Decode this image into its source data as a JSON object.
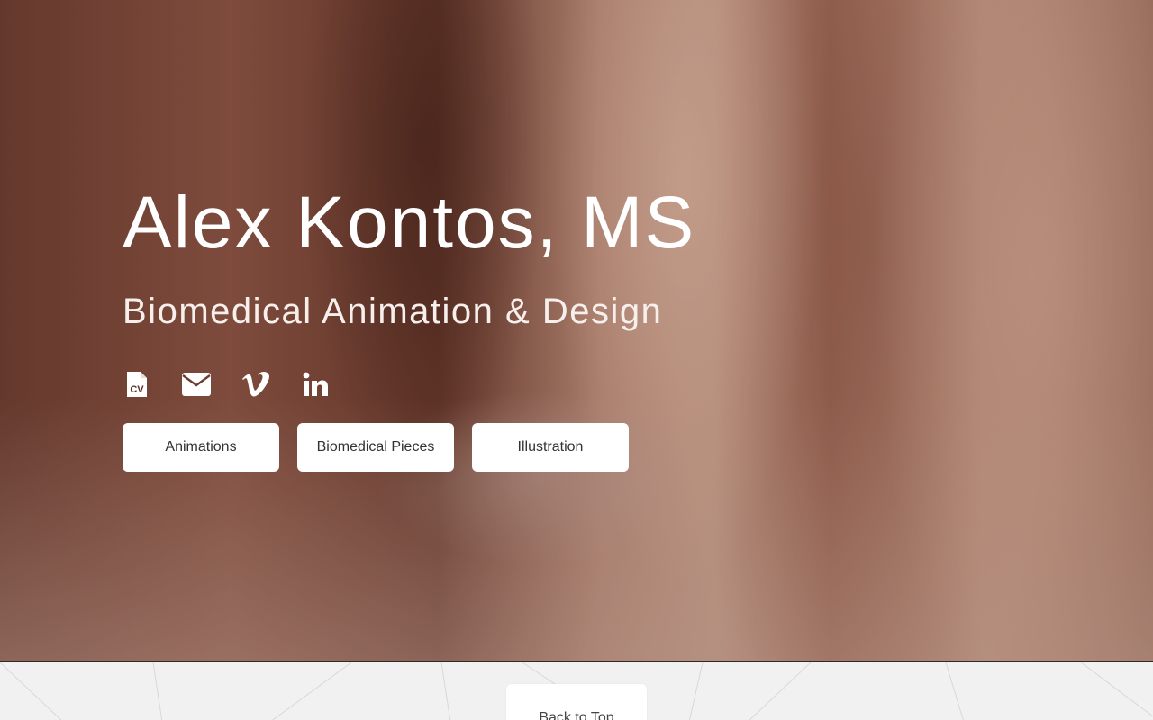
{
  "hero": {
    "title": "Alex Kontos, MS",
    "subtitle": "Biomedical Animation & Design"
  },
  "social": [
    {
      "icon": "cv-file-icon",
      "label": "CV"
    },
    {
      "icon": "envelope-icon"
    },
    {
      "icon": "vimeo-icon"
    },
    {
      "icon": "linkedin-icon"
    }
  ],
  "nav_buttons": [
    {
      "label": "Animations"
    },
    {
      "label": "Biomedical Pieces"
    },
    {
      "label": "Illustration"
    }
  ],
  "footer": {
    "back_to_top": "Back to Top"
  },
  "colors": {
    "text_light": "#ffffff",
    "button_bg": "#ffffff",
    "button_text": "#333333",
    "footer_bg": "#f1f1f1"
  }
}
